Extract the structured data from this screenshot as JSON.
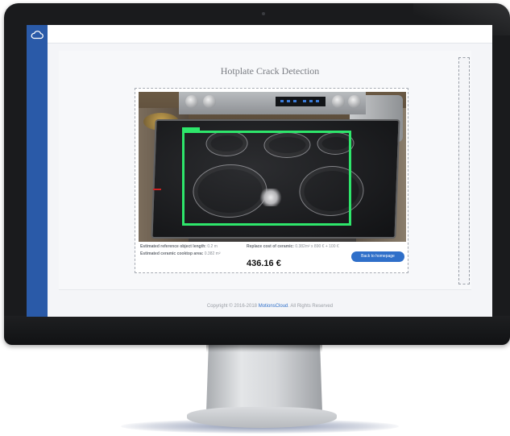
{
  "app": {
    "page_title": "Hotplate Crack Detection",
    "sidebar_logo": "cloud-icon"
  },
  "result": {
    "ref_label": "Estimated reference object length:",
    "ref_value": "0.2 m",
    "area_label": "Estimated ceramic cooktop area:",
    "area_value": "0.382 m²",
    "replace_label": "Replace cost of ceramic:",
    "replace_formula": "0.382m² x 890 € + 100 €",
    "price": "436.16 €",
    "back_button": "Back to homepage"
  },
  "footer": {
    "copyright": "Copyright © 2016-2018",
    "brand": "MotionsCloud",
    "rights": ". All Rights Reserved"
  },
  "colors": {
    "sidebar": "#2a5aa8",
    "accent": "#2f6fc9",
    "detection_box": "#2ee66b"
  }
}
